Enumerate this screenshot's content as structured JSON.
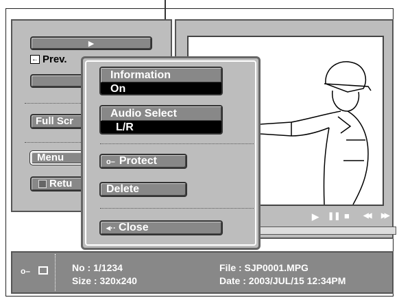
{
  "left_panel": {
    "play_glyph": "►",
    "prev_label": "Prev.",
    "full_screen_label": "Full Scr",
    "menu_label": "Menu",
    "return_label": "Retu"
  },
  "popup": {
    "information": {
      "label": "Information",
      "value": "On"
    },
    "audio_select": {
      "label": "Audio Select",
      "value": "L/R"
    },
    "protect_label": "Protect",
    "delete_label": "Delete",
    "close_label": "Close"
  },
  "playback_controls": {
    "play": "▶",
    "pause": "❚❚",
    "stop": "■",
    "rewind": "◀◀",
    "forward": "▶▶"
  },
  "info_bar": {
    "no": "No   : 1/1234",
    "size": "Size : 320x240",
    "file": "File  : SJP0001.MPG",
    "date": "Date : 2003/JUL/15 12:34PM"
  },
  "icons": [
    "key-icon",
    "film-icon",
    "home-icon",
    "arrow-left-icon",
    "play-icon"
  ],
  "colors": {
    "panel": "#bdbdbd",
    "button": "#888888",
    "value_bg": "#000000",
    "info_bar": "#888888"
  }
}
